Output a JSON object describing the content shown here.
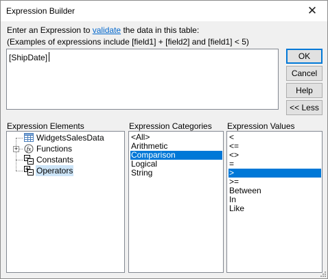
{
  "window": {
    "title": "Expression Builder"
  },
  "instructions": {
    "line1_before": "Enter an Expression to ",
    "line1_link": "validate",
    "line1_after": " the data in this table:",
    "line2": "(Examples of expressions include [field1] + [field2] and [field1] < 5)"
  },
  "editor": {
    "value": "[ShipDate]"
  },
  "buttons": {
    "ok": "OK",
    "cancel": "Cancel",
    "help": "Help",
    "less": "<< Less"
  },
  "elements": {
    "label": "Expression Elements",
    "items": [
      {
        "label": "WidgetsSalesData",
        "icon": "table-icon"
      },
      {
        "label": "Functions",
        "icon": "function-icon"
      },
      {
        "label": "Constants",
        "icon": "constants-icon"
      },
      {
        "label": "Operators",
        "icon": "operators-icon"
      }
    ]
  },
  "categories": {
    "label": "Expression Categories",
    "items": [
      "<All>",
      "Arithmetic",
      "Comparison",
      "Logical",
      "String"
    ],
    "selected": "Comparison"
  },
  "values": {
    "label": "Expression Values",
    "items": [
      "<",
      "<=",
      "<>",
      "=",
      ">",
      ">=",
      "Between",
      "In",
      "Like"
    ],
    "selected": ">"
  },
  "colors": {
    "selection": "#0078d7",
    "link": "#0066cc",
    "dialog_bg": "#f0f0f0"
  }
}
